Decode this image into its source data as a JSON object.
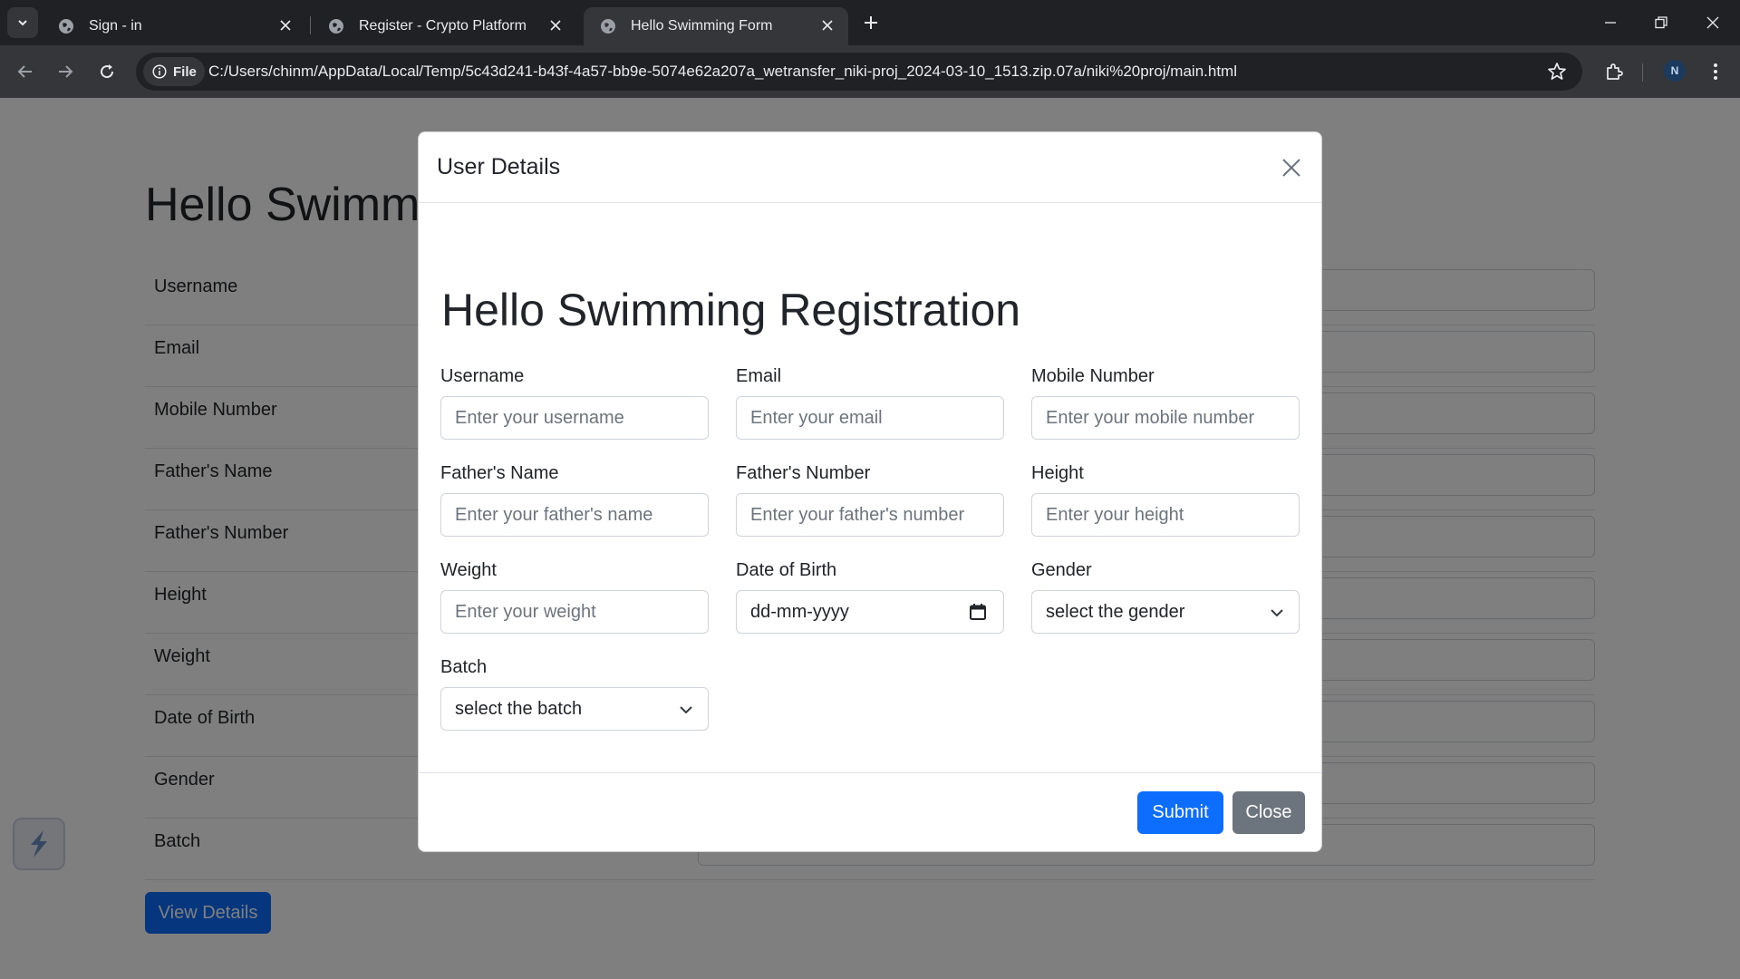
{
  "browser": {
    "tabs": [
      {
        "title": "Sign - in",
        "active": false
      },
      {
        "title": "Register - Crypto Platform",
        "active": false
      },
      {
        "title": "Hello Swimming Form",
        "active": true
      }
    ],
    "chip_label": "File",
    "url": "C:/Users/chinm/AppData/Local/Temp/5c43d241-b43f-4a57-bb9e-5074e62a207a_wetransfer_niki-proj_2024-03-10_1513.zip.07a/niki%20proj/main.html",
    "profile_initial": "N"
  },
  "background_page": {
    "title": "Hello Swimm",
    "rows": [
      "Username",
      "Email",
      "Mobile Number",
      "Father's Name",
      "Father's Number",
      "Height",
      "Weight",
      "Date of Birth",
      "Gender",
      "Batch"
    ],
    "view_details_label": "View Details"
  },
  "modal": {
    "title": "User Details",
    "form_title": "Hello Swimming Registration",
    "fields": {
      "username": {
        "label": "Username",
        "placeholder": "Enter your username"
      },
      "email": {
        "label": "Email",
        "placeholder": "Enter your email"
      },
      "mobile": {
        "label": "Mobile Number",
        "placeholder": "Enter your mobile number"
      },
      "father_name": {
        "label": "Father's Name",
        "placeholder": "Enter your father's name"
      },
      "father_number": {
        "label": "Father's Number",
        "placeholder": "Enter your father's number"
      },
      "height": {
        "label": "Height",
        "placeholder": "Enter your height"
      },
      "weight": {
        "label": "Weight",
        "placeholder": "Enter your weight"
      },
      "dob": {
        "label": "Date of Birth",
        "value": "dd-mm-yyyy"
      },
      "gender": {
        "label": "Gender",
        "value": "select the gender"
      },
      "batch": {
        "label": "Batch",
        "value": "select the batch"
      }
    },
    "submit_label": "Submit",
    "close_label": "Close"
  },
  "colors": {
    "primary": "#0d6efd",
    "secondary": "#6c757d",
    "chrome_dark": "#202124",
    "chrome_toolbar": "#35363a"
  },
  "icons": [
    "tab-list-icon",
    "globe-icon",
    "close-icon",
    "plus-icon",
    "minimize-icon",
    "restore-icon",
    "back-icon",
    "forward-icon",
    "reload-icon",
    "info-icon",
    "star-icon",
    "extensions-icon",
    "more-icon",
    "calendar-icon",
    "chevron-down-icon"
  ]
}
